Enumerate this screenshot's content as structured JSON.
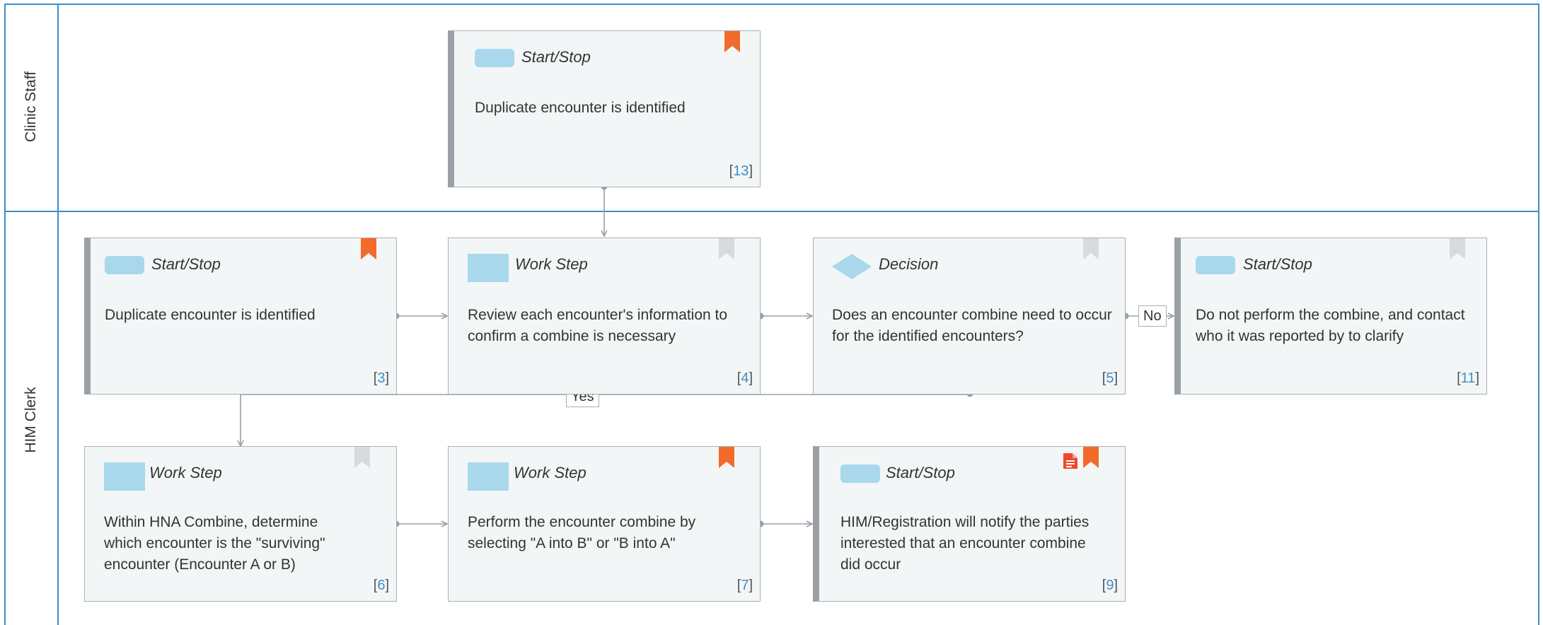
{
  "lanes": [
    {
      "label": "Clinic Staff"
    },
    {
      "label": "HIM Clerk"
    }
  ],
  "nodes": {
    "n13": {
      "type": "Start/Stop",
      "text": "Duplicate encounter is identified",
      "num": "13"
    },
    "n3": {
      "type": "Start/Stop",
      "text": "Duplicate encounter is identified",
      "num": "3"
    },
    "n4": {
      "type": "Work Step",
      "text": "Review each encounter's information to confirm a combine is necessary",
      "num": "4"
    },
    "n5": {
      "type": "Decision",
      "text": "Does an encounter combine need to occur for the identified encounters?",
      "num": "5"
    },
    "n11": {
      "type": "Start/Stop",
      "text": "Do not perform the combine, and contact who it was reported by to clarify",
      "num": "11"
    },
    "n6": {
      "type": "Work Step",
      "text": "Within HNA Combine, determine which encounter is the \"surviving\" encounter (Encounter A or B)",
      "num": "6"
    },
    "n7": {
      "type": "Work Step",
      "text": "Perform the encounter combine by selecting \"A into B\" or \"B into A\"",
      "num": "7"
    },
    "n9": {
      "type": "Start/Stop",
      "text": "HIM/Registration will notify the parties interested that an encounter combine did occur",
      "num": "9"
    }
  },
  "edge_labels": {
    "no": "No",
    "yes": "Yes"
  },
  "icons": {
    "bookmark_active": "bookmark-orange-icon",
    "bookmark_inactive": "bookmark-gray-icon",
    "document": "document-icon"
  },
  "colors": {
    "lane_border": "#3d8fc7",
    "shape_fill": "#a9d8ec",
    "bookmark_active": "#f26b2a",
    "bookmark_inactive": "#d7dbde",
    "node_fill": "#f3f6f7",
    "link_number": "#3d8fc7"
  }
}
